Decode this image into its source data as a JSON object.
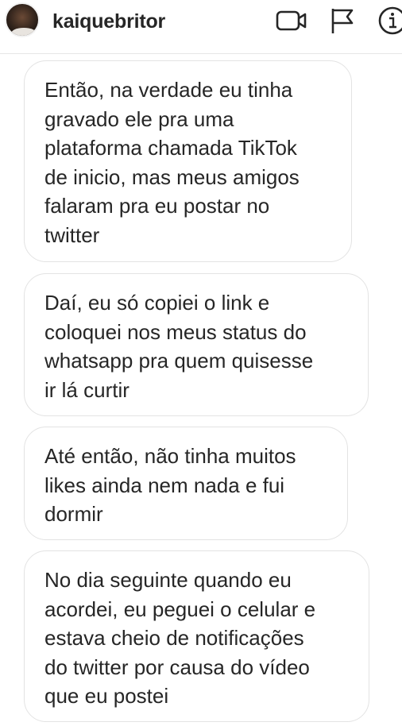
{
  "header": {
    "username": "kaiquebritor",
    "icons": [
      "video-call-icon",
      "flag-icon",
      "info-icon"
    ]
  },
  "messages": [
    "Então, na verdade eu tinha\ngravado ele pra uma\nplataforma chamada TikTok\nde inicio, mas meus amigos\nfalaram pra eu postar no\ntwitter",
    "Daí, eu só copiei o link e\ncoloquei nos meus status do\nwhatsapp pra quem quisesse\nir lá curtir",
    "Até então, não tinha muitos\nlikes ainda nem nada e fui\ndormir",
    "No dia seguinte quando eu\nacordei, eu peguei o celular e\nestava cheio de notificações\ndo twitter por causa do vídeo\nque eu postei"
  ],
  "colors": {
    "text": "#262626",
    "bubble_border": "#e3e3e3",
    "background": "#ffffff"
  }
}
